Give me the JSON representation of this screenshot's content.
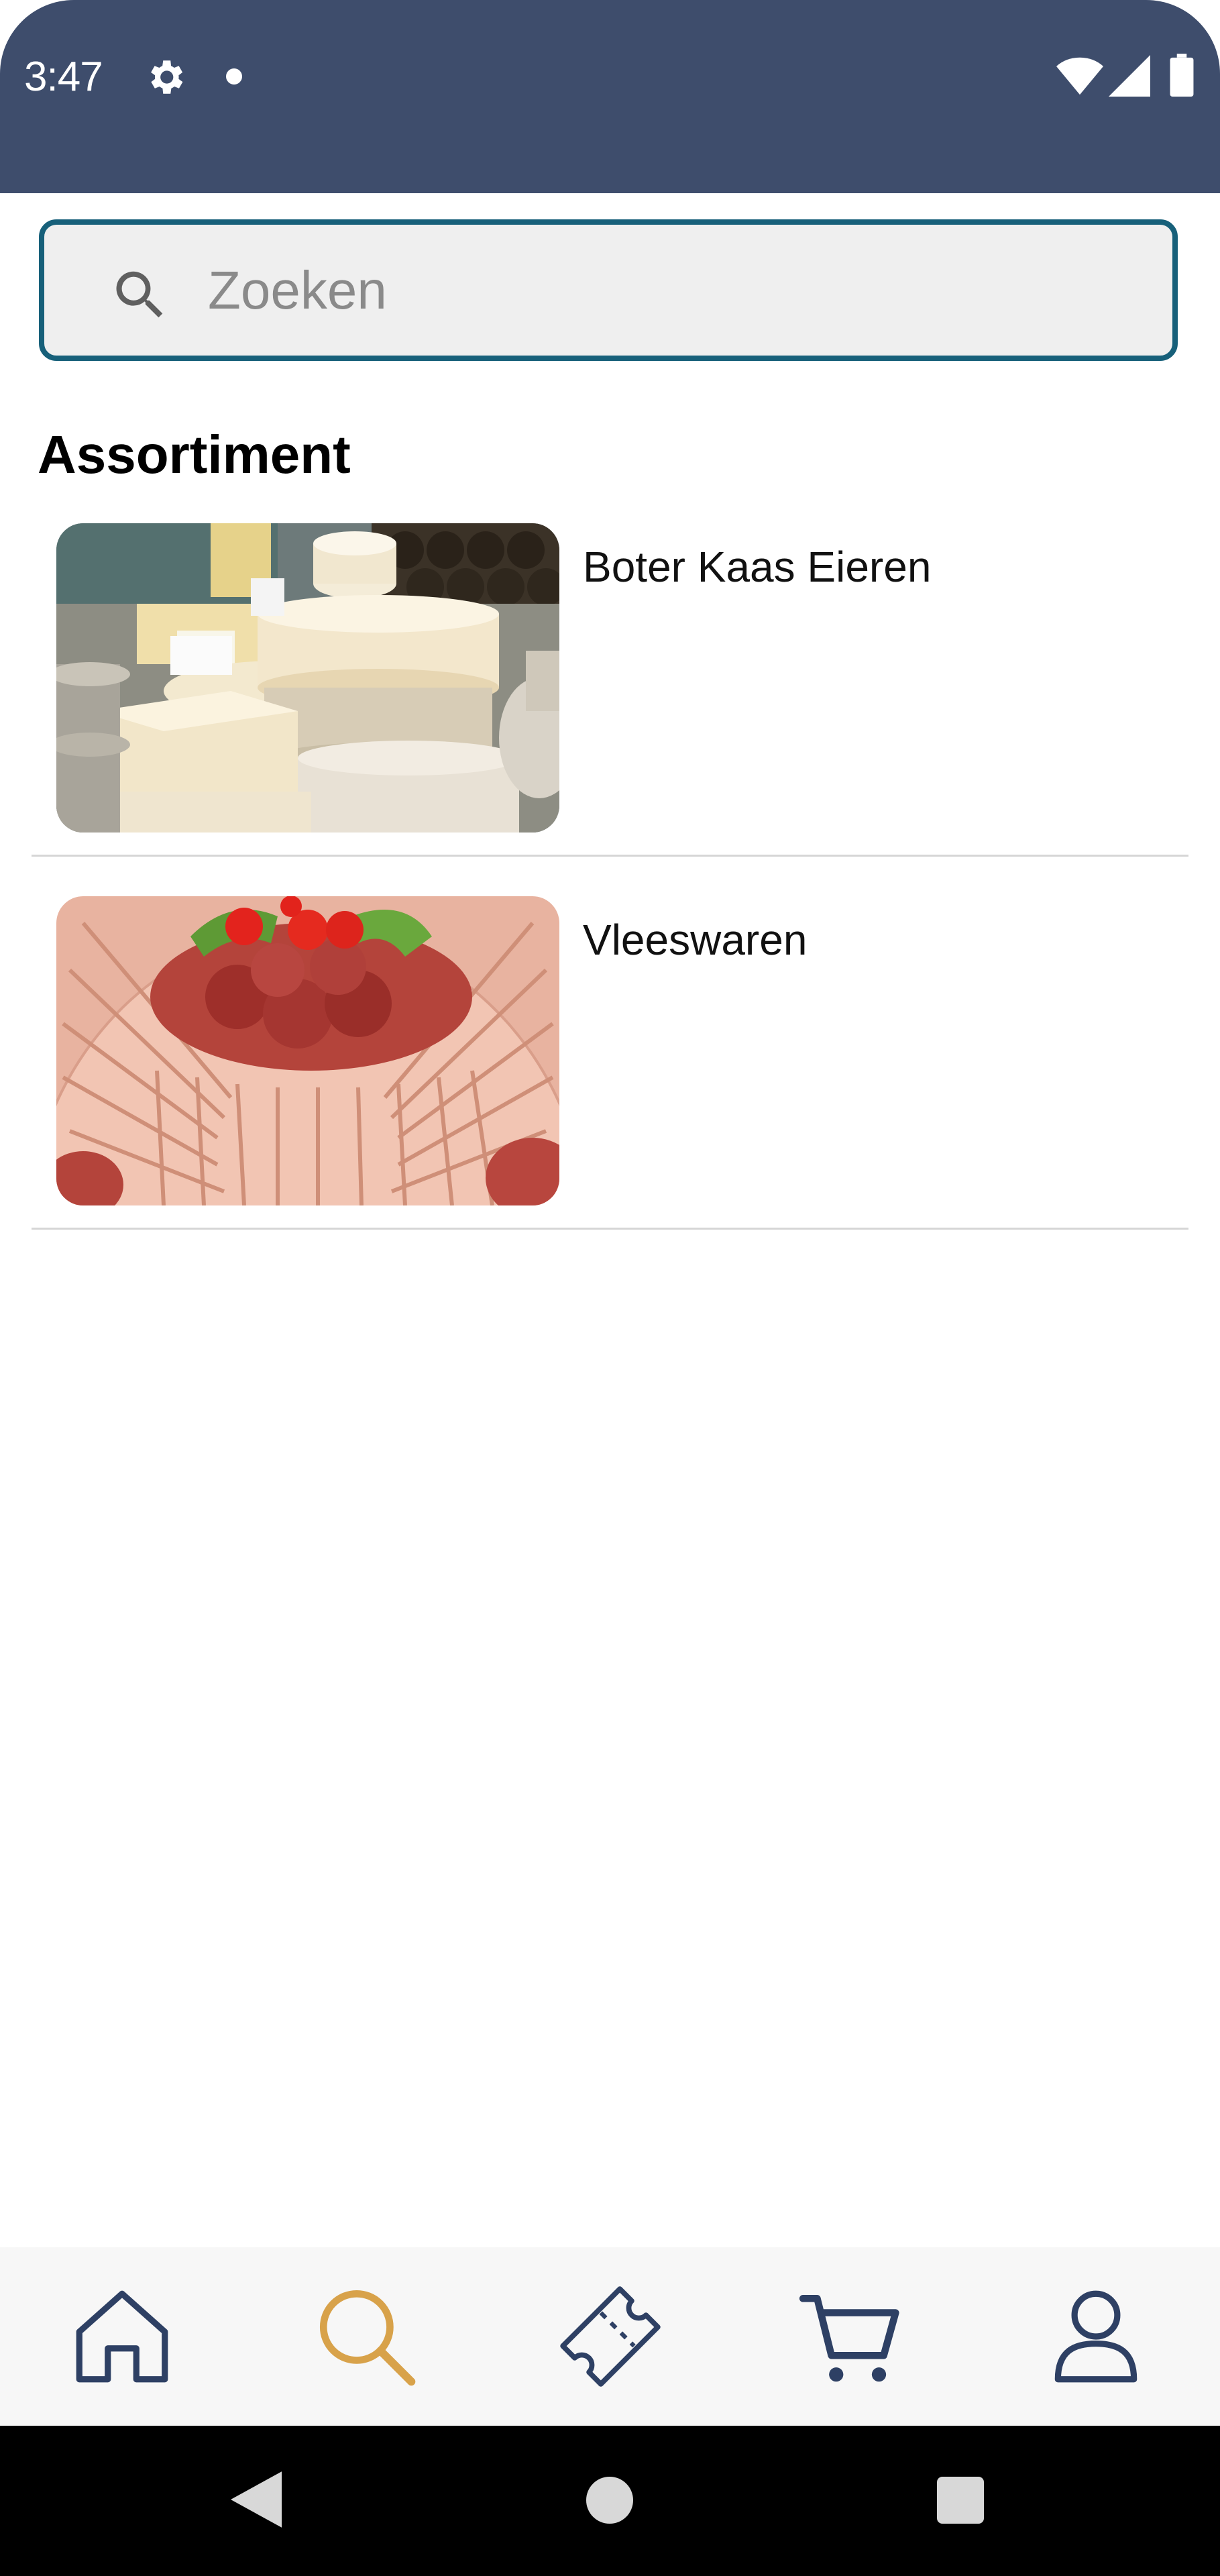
{
  "status_bar": {
    "time": "3:47",
    "icons": [
      "gear-icon",
      "notification-dot",
      "wifi-icon",
      "signal-icon",
      "battery-icon"
    ]
  },
  "search": {
    "placeholder": "Zoeken",
    "value": ""
  },
  "section": {
    "title": "Assortiment"
  },
  "categories": [
    {
      "label": "Boter Kaas Eieren",
      "image": "cheese-photo"
    },
    {
      "label": "Vleeswaren",
      "image": "cold-cuts-photo"
    }
  ],
  "bottom_nav": {
    "items": [
      {
        "name": "home",
        "icon": "home-icon",
        "active": false
      },
      {
        "name": "search",
        "icon": "search-icon",
        "active": true
      },
      {
        "name": "coupons",
        "icon": "ticket-icon",
        "active": false
      },
      {
        "name": "cart",
        "icon": "cart-icon",
        "active": false
      },
      {
        "name": "account",
        "icon": "user-icon",
        "active": false
      }
    ]
  },
  "colors": {
    "header": "#3e4d6c",
    "search_border": "#17607a",
    "nav_icon": "#2e4064",
    "nav_active": "#d8a24a"
  }
}
